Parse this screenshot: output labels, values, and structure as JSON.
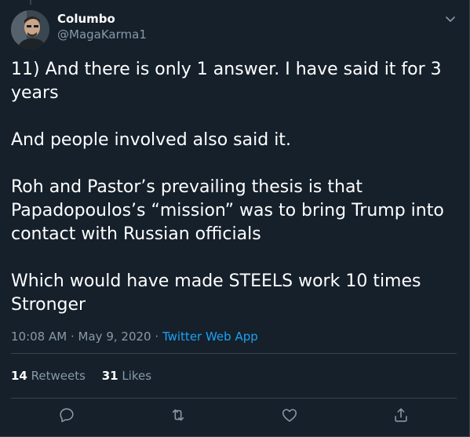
{
  "tweet": {
    "author": {
      "name": "Columbo",
      "handle": "@MagaKarma1"
    },
    "paragraphs": [
      "11) And there is only 1 answer. I have said it for 3 years",
      "And people involved also said it.",
      "Roh and Pastor’s prevailing thesis is that Papadopoulos’s “mission” was to bring Trump into contact with Russian officials",
      "Which would have made STEELS work 10 times Stronger"
    ],
    "time": "10:08 AM",
    "separator": "·",
    "date": "May 9, 2020",
    "source": "Twitter Web App",
    "stats": {
      "retweets_count": "14",
      "retweets_label": "Retweets",
      "likes_count": "31",
      "likes_label": "Likes"
    }
  },
  "icons": {
    "more": "chevron-down-icon",
    "reply": "reply-icon",
    "retweet": "retweet-icon",
    "like": "heart-icon",
    "share": "share-icon"
  },
  "colors": {
    "background": "#15202b",
    "text": "#ffffff",
    "secondary_text": "#8899a6",
    "link": "#1da1f2",
    "divider": "#38444d"
  }
}
